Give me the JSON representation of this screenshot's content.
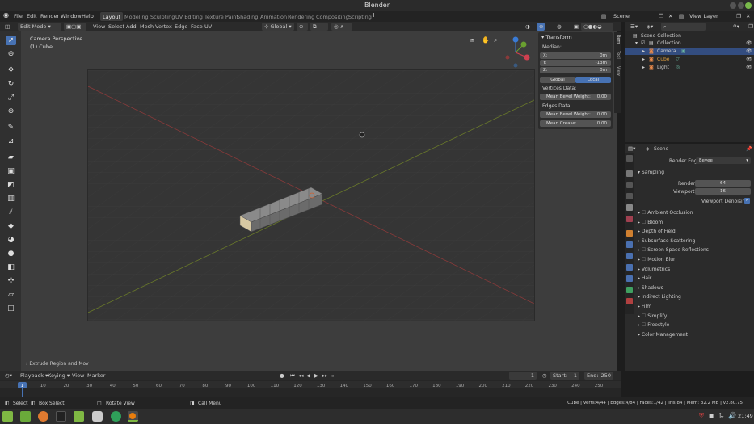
{
  "app_title": "Blender",
  "menu": [
    "File",
    "Edit",
    "Render",
    "Window",
    "Help"
  ],
  "workspaces": [
    "Layout",
    "Modeling",
    "Sculpting",
    "UV Editing",
    "Texture Paint",
    "Shading",
    "Animation",
    "Rendering",
    "Compositing",
    "Scripting"
  ],
  "active_workspace": "Layout",
  "scene_label": "Scene",
  "view_layer_label": "View Layer",
  "viewport_header": {
    "mode": "Edit Mode",
    "menus": [
      "View",
      "Select",
      "Add",
      "Mesh",
      "Vertex",
      "Edge",
      "Face",
      "UV"
    ],
    "orientation": "Global"
  },
  "viewport": {
    "view_name": "Camera Perspective",
    "object_name": "(1) Cube",
    "last_op": "Extrude Region and Mov"
  },
  "n_panel": {
    "title": "Transform",
    "median_label": "Median:",
    "x": {
      "label": "X:",
      "value": "0m"
    },
    "y": {
      "label": "Y:",
      "value": "-13m"
    },
    "z": {
      "label": "Z:",
      "value": "0m"
    },
    "global": "Global",
    "local": "Local",
    "vertices_data": "Vertices Data:",
    "mean_bevel_weight_label": "Mean Bevel Weight:",
    "mean_bevel_weight_v": "0.00",
    "edges_data": "Edges Data:",
    "mean_bevel_weight_e": "0.00",
    "mean_crease_label": "Mean Crease:",
    "mean_crease": "0.00",
    "tabs": [
      "Item",
      "Tool",
      "View"
    ]
  },
  "outliner": {
    "root": "Scene Collection",
    "items": [
      {
        "name": "Collection",
        "color": "#cccccc"
      },
      {
        "name": "Camera",
        "color": "#cccccc"
      },
      {
        "name": "Cube",
        "color": "#e0a040"
      },
      {
        "name": "Light",
        "color": "#cccccc"
      }
    ]
  },
  "properties": {
    "scene": "Scene",
    "render_engine_label": "Render Engine",
    "render_engine": "Eevee",
    "sampling": "Sampling",
    "render_label": "Render",
    "render_value": "64",
    "viewport_label": "Viewport",
    "viewport_value": "16",
    "viewport_denoising": "Viewport Denoising",
    "sections": [
      {
        "label": "Ambient Occlusion",
        "checkbox": true
      },
      {
        "label": "Bloom",
        "checkbox": true
      },
      {
        "label": "Depth of Field",
        "checkbox": false
      },
      {
        "label": "Subsurface Scattering",
        "checkbox": false
      },
      {
        "label": "Screen Space Reflections",
        "checkbox": true
      },
      {
        "label": "Motion Blur",
        "checkbox": true
      },
      {
        "label": "Volumetrics",
        "checkbox": false
      },
      {
        "label": "Hair",
        "checkbox": false
      },
      {
        "label": "Shadows",
        "checkbox": false
      },
      {
        "label": "Indirect Lighting",
        "checkbox": false
      },
      {
        "label": "Film",
        "checkbox": false
      },
      {
        "label": "Simplify",
        "checkbox": true
      },
      {
        "label": "Freestyle",
        "checkbox": true
      },
      {
        "label": "Color Management",
        "checkbox": false
      }
    ]
  },
  "timeline": {
    "menus": [
      "Playback",
      "Keying",
      "View",
      "Marker"
    ],
    "current_frame": "1",
    "start_label": "Start:",
    "start": "1",
    "end_label": "End:",
    "end": "250",
    "ticks": [
      "10",
      "20",
      "30",
      "40",
      "50",
      "60",
      "70",
      "80",
      "90",
      "100",
      "110",
      "120",
      "130",
      "140",
      "150",
      "160",
      "170",
      "180",
      "190",
      "200",
      "210",
      "220",
      "230",
      "240",
      "250"
    ],
    "playhead": "1"
  },
  "status": {
    "select": "Select",
    "box_select": "Box Select",
    "rotate_view": "Rotate View",
    "call_menu": "Call Menu",
    "stats": "Cube | Verts:4/44 | Edges:4/84 | Faces:1/42 | Tris:84 | Mem: 32.2 MB | v2.80.75"
  },
  "taskbar": {
    "time": "21:49",
    "icons": [
      "menu-icon",
      "files-icon",
      "firefox-icon",
      "terminal-icon",
      "folder-icon",
      "screenshot-icon",
      "mint-update-icon",
      "blender-icon"
    ]
  }
}
